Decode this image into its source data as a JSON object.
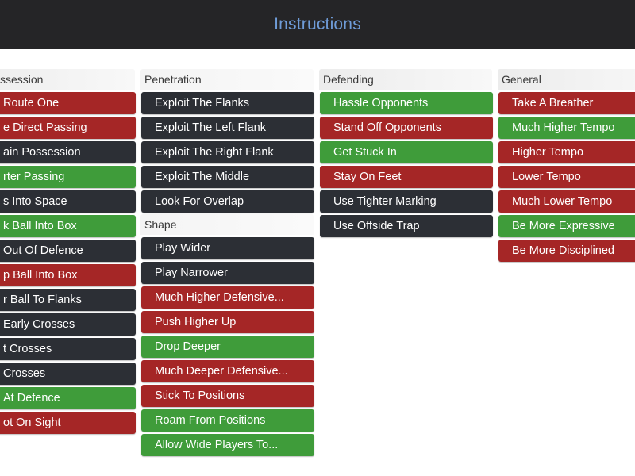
{
  "header": {
    "title": "Instructions"
  },
  "colors": {
    "red": "#a52626",
    "green": "#3f9c3a",
    "dark": "#2c2f35",
    "header_bg": "#252527",
    "title": "#6f9cd8"
  },
  "columns": [
    {
      "title": "ssession",
      "items": [
        {
          "label": "Route One",
          "status": "red"
        },
        {
          "label": "e Direct Passing",
          "status": "red"
        },
        {
          "label": "ain Possession",
          "status": "dark"
        },
        {
          "label": "rter Passing",
          "status": "green"
        },
        {
          "label": "s Into Space",
          "status": "dark"
        },
        {
          "label": "k Ball Into Box",
          "status": "green"
        },
        {
          "label": "Out Of Defence",
          "status": "dark"
        },
        {
          "label": "p Ball Into Box",
          "status": "red"
        },
        {
          "label": "r Ball To Flanks",
          "status": "dark"
        },
        {
          "label": "Early Crosses",
          "status": "dark"
        },
        {
          "label": "t Crosses",
          "status": "dark"
        },
        {
          "label": "Crosses",
          "status": "dark"
        },
        {
          "label": "At Defence",
          "status": "green"
        },
        {
          "label": "ot On Sight",
          "status": "red"
        }
      ]
    },
    {
      "title": "Penetration",
      "items": [
        {
          "label": "Exploit The Flanks",
          "status": "dark"
        },
        {
          "label": "Exploit The Left Flank",
          "status": "dark"
        },
        {
          "label": "Exploit The Right Flank",
          "status": "dark"
        },
        {
          "label": "Exploit The Middle",
          "status": "dark"
        },
        {
          "label": "Look For Overlap",
          "status": "dark"
        }
      ],
      "subtitle": "Shape",
      "sub_items": [
        {
          "label": "Play Wider",
          "status": "dark"
        },
        {
          "label": "Play Narrower",
          "status": "dark"
        },
        {
          "label": "Much Higher Defensive...",
          "status": "red"
        },
        {
          "label": "Push Higher Up",
          "status": "red"
        },
        {
          "label": "Drop Deeper",
          "status": "green"
        },
        {
          "label": "Much Deeper Defensive...",
          "status": "red"
        },
        {
          "label": "Stick To Positions",
          "status": "red"
        },
        {
          "label": "Roam From Positions",
          "status": "green"
        },
        {
          "label": "Allow Wide Players To...",
          "status": "green"
        }
      ]
    },
    {
      "title": "Defending",
      "items": [
        {
          "label": "Hassle Opponents",
          "status": "green"
        },
        {
          "label": "Stand Off Opponents",
          "status": "red"
        },
        {
          "label": "Get Stuck In",
          "status": "green"
        },
        {
          "label": "Stay On Feet",
          "status": "red"
        },
        {
          "label": "Use Tighter Marking",
          "status": "dark"
        },
        {
          "label": "Use Offside Trap",
          "status": "dark"
        }
      ]
    },
    {
      "title": "General",
      "items": [
        {
          "label": "Take A Breather",
          "status": "red"
        },
        {
          "label": "Much Higher Tempo",
          "status": "green"
        },
        {
          "label": "Higher Tempo",
          "status": "red"
        },
        {
          "label": "Lower Tempo",
          "status": "red"
        },
        {
          "label": "Much Lower Tempo",
          "status": "red"
        },
        {
          "label": "Be More Expressive",
          "status": "green"
        },
        {
          "label": "Be More Disciplined",
          "status": "red"
        }
      ]
    }
  ]
}
